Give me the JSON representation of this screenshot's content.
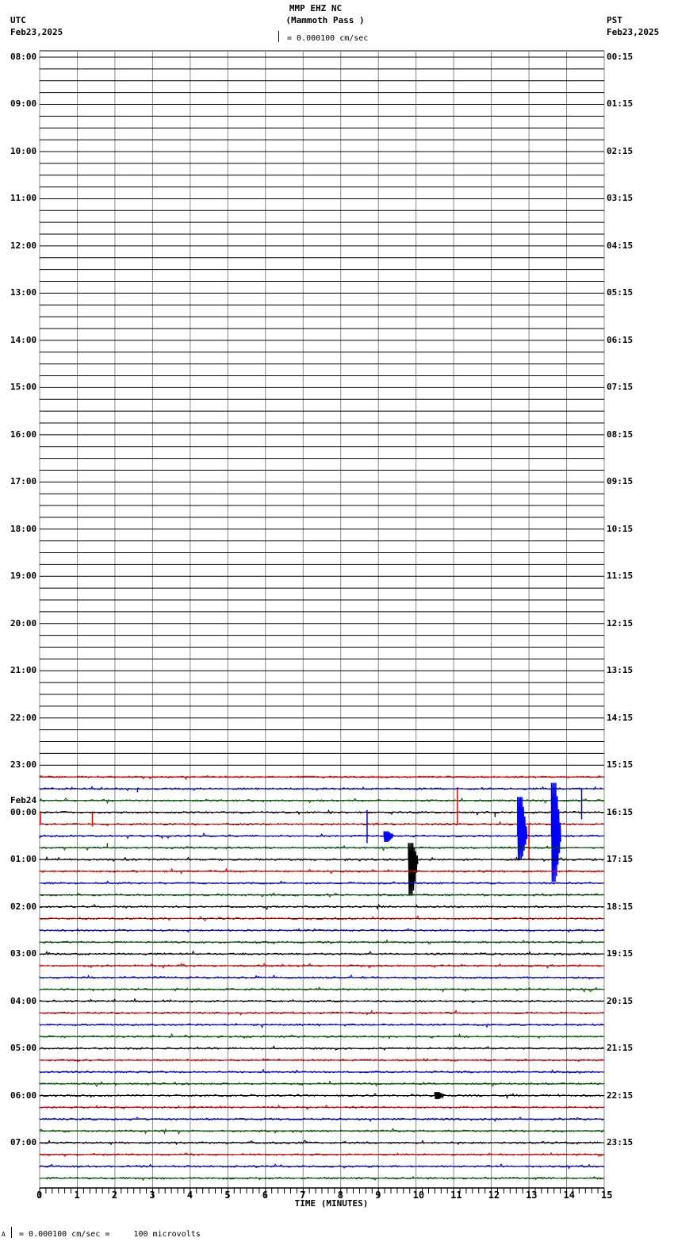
{
  "header": {
    "station": "MMP EHZ NC",
    "location": "(Mammoth Pass )",
    "scale_text": "= 0.000100 cm/sec",
    "left_tz": "UTC",
    "left_date": "Feb23,2025",
    "right_tz": "PST",
    "right_date": "Feb23,2025",
    "day_change_label": "Feb24"
  },
  "footer": {
    "scale_text": "= 0.000100 cm/sec =     100 microvolts",
    "mark": "A"
  },
  "chart_data": {
    "type": "line",
    "title": "MMP EHZ NC (Mammoth Pass )",
    "xlabel": "TIME (MINUTES)",
    "xlim": [
      0,
      15
    ],
    "x_ticks": [
      "0",
      "1",
      "2",
      "3",
      "4",
      "5",
      "6",
      "7",
      "8",
      "9",
      "10",
      "11",
      "12",
      "13",
      "14",
      "15"
    ],
    "rows_per_hour": 4,
    "left_hour_labels": [
      "08:00",
      "09:00",
      "10:00",
      "11:00",
      "12:00",
      "13:00",
      "14:00",
      "15:00",
      "16:00",
      "17:00",
      "18:00",
      "19:00",
      "20:00",
      "21:00",
      "22:00",
      "23:00",
      "00:00",
      "01:00",
      "02:00",
      "03:00",
      "04:00",
      "05:00",
      "06:00",
      "07:00"
    ],
    "right_hour_labels": [
      "00:15",
      "01:15",
      "02:15",
      "03:15",
      "04:15",
      "05:15",
      "06:15",
      "07:15",
      "08:15",
      "09:15",
      "10:15",
      "11:15",
      "12:15",
      "13:15",
      "14:15",
      "15:15",
      "16:15",
      "17:15",
      "18:15",
      "19:15",
      "20:15",
      "21:15",
      "22:15",
      "23:15"
    ],
    "first_data_row": 61,
    "total_rows": 96,
    "trace_colors": [
      "#ff0000",
      "#0000ff",
      "#006400",
      "#000000"
    ],
    "events": [
      {
        "row": 65,
        "minute": 0.02,
        "up": 1.0,
        "down": 0,
        "burst": false
      },
      {
        "row": 65,
        "minute": 1.4,
        "up": 1.0,
        "down": 0.2,
        "burst": false
      },
      {
        "row": 67,
        "minute": 1.8,
        "up": 0.4,
        "down": 0,
        "burst": false
      },
      {
        "row": 62,
        "minute": 2.6,
        "up": 0,
        "down": 0.3,
        "burst": false
      },
      {
        "row": 66,
        "minute": 8.7,
        "up": 2.2,
        "down": 0.6,
        "burst": false
      },
      {
        "row": 66,
        "minute": 9.15,
        "up": 0.4,
        "down": 0.5,
        "burst": true
      },
      {
        "row": 68,
        "minute": 9.8,
        "up": 1.4,
        "down": 3.0,
        "burst": true
      },
      {
        "row": 65,
        "minute": 11.1,
        "up": 3.0,
        "down": 0,
        "burst": false
      },
      {
        "row": 64,
        "minute": 12.1,
        "up": 0,
        "down": 0.4,
        "burst": false
      },
      {
        "row": 66,
        "minute": 12.7,
        "up": 3.3,
        "down": 2.0,
        "burst": true
      },
      {
        "row": 65,
        "minute": 13.0,
        "up": 0,
        "down": 3.0,
        "burst": false
      },
      {
        "row": 66,
        "minute": 13.6,
        "up": 4.5,
        "down": 3.9,
        "burst": true
      },
      {
        "row": 62,
        "minute": 14.4,
        "up": 0,
        "down": 2.6,
        "burst": false
      },
      {
        "row": 88,
        "minute": 10.5,
        "up": 0.3,
        "down": 0.3,
        "burst": true
      }
    ]
  }
}
